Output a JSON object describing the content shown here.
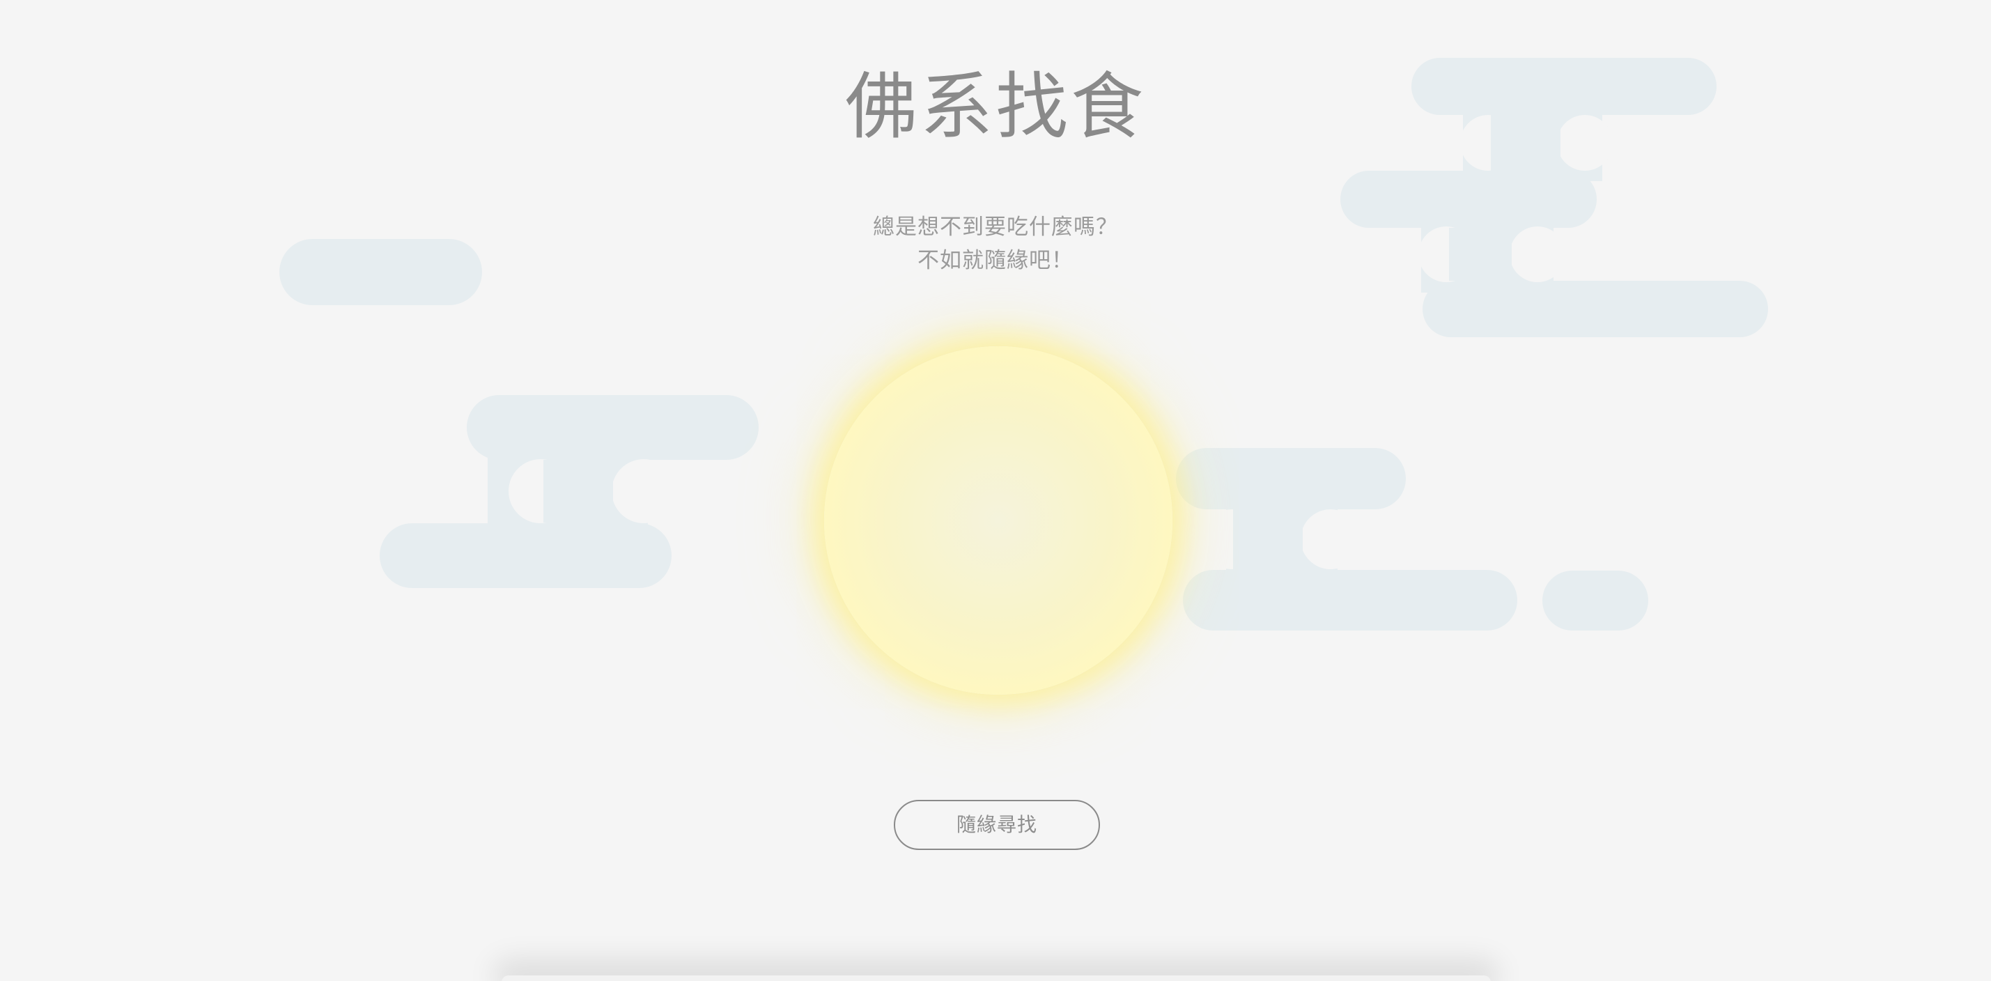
{
  "app": {
    "title": "佛系找食",
    "subtitle_lines": [
      "總是想不到要吃什麼嗎？",
      "不如就隨緣吧！"
    ]
  },
  "action": {
    "button_label": "隨緣尋找"
  },
  "colors": {
    "background": "#f5f5f5",
    "cloud": "#e6edf0",
    "sun": "#fff7b7",
    "sun_glow": "#ffec78",
    "text": "#8a8a8a"
  },
  "decor": {
    "icons": [
      "cloud-icon",
      "sun-icon"
    ]
  }
}
